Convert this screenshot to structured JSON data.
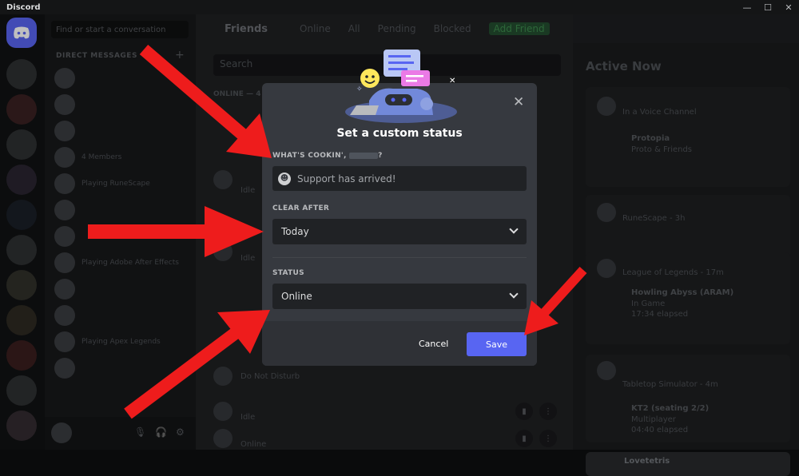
{
  "titlebar": {
    "app_name": "Discord"
  },
  "channels": {
    "search_placeholder": "Find or start a conversation",
    "dm_header": "DIRECT MESSAGES",
    "dms": [
      {
        "label": ""
      },
      {
        "label": ""
      },
      {
        "label": ""
      },
      {
        "label": "4 Members"
      },
      {
        "label": "Playing RuneScape"
      },
      {
        "label": ""
      },
      {
        "label": ""
      },
      {
        "label": "Playing Adobe After Effects"
      },
      {
        "label": ""
      },
      {
        "label": ""
      },
      {
        "label": "Playing Apex Legends"
      },
      {
        "label": ""
      }
    ]
  },
  "nav": {
    "friends": "Friends",
    "online": "Online",
    "all": "All",
    "pending": "Pending",
    "blocked": "Blocked",
    "add_friend": "Add Friend"
  },
  "main": {
    "search_placeholder": "Search",
    "online_header": "ONLINE — 4",
    "rows": [
      {
        "status": "Idle"
      },
      {
        "status": "Idle"
      },
      {
        "status": "Do Not Disturb"
      },
      {
        "status": "Idle"
      },
      {
        "status": "Online"
      }
    ]
  },
  "active_now": {
    "title": "Active Now",
    "cards": [
      {
        "line1": "In a Voice Channel",
        "name": "Protopia",
        "sub": "Proto & Friends"
      },
      {
        "line1": "RuneScape - 3h"
      },
      {
        "line1": "League of Legends - 17m",
        "name": "Howling Abyss (ARAM)",
        "sub": "In Game",
        "sub2": "17:34 elapsed"
      },
      {
        "line1": "Tabletop Simulator - 4m",
        "name": "KT2 (seating 2/2)",
        "sub": "Multiplayer",
        "sub2": "04:40 elapsed"
      },
      {
        "line1": "Lovetetris"
      }
    ]
  },
  "modal": {
    "title": "Set a custom status",
    "whats_cookin_label": "WHAT'S COOKIN',",
    "whats_cookin_suffix": "?",
    "status_placeholder": "Support has arrived!",
    "clear_after_label": "CLEAR AFTER",
    "clear_after_value": "Today",
    "status_label": "STATUS",
    "status_value": "Online",
    "cancel_label": "Cancel",
    "save_label": "Save"
  },
  "colors": {
    "blurple": "#5865f2",
    "arrow": "#ee1c1c",
    "modal_bg": "#36393f"
  }
}
